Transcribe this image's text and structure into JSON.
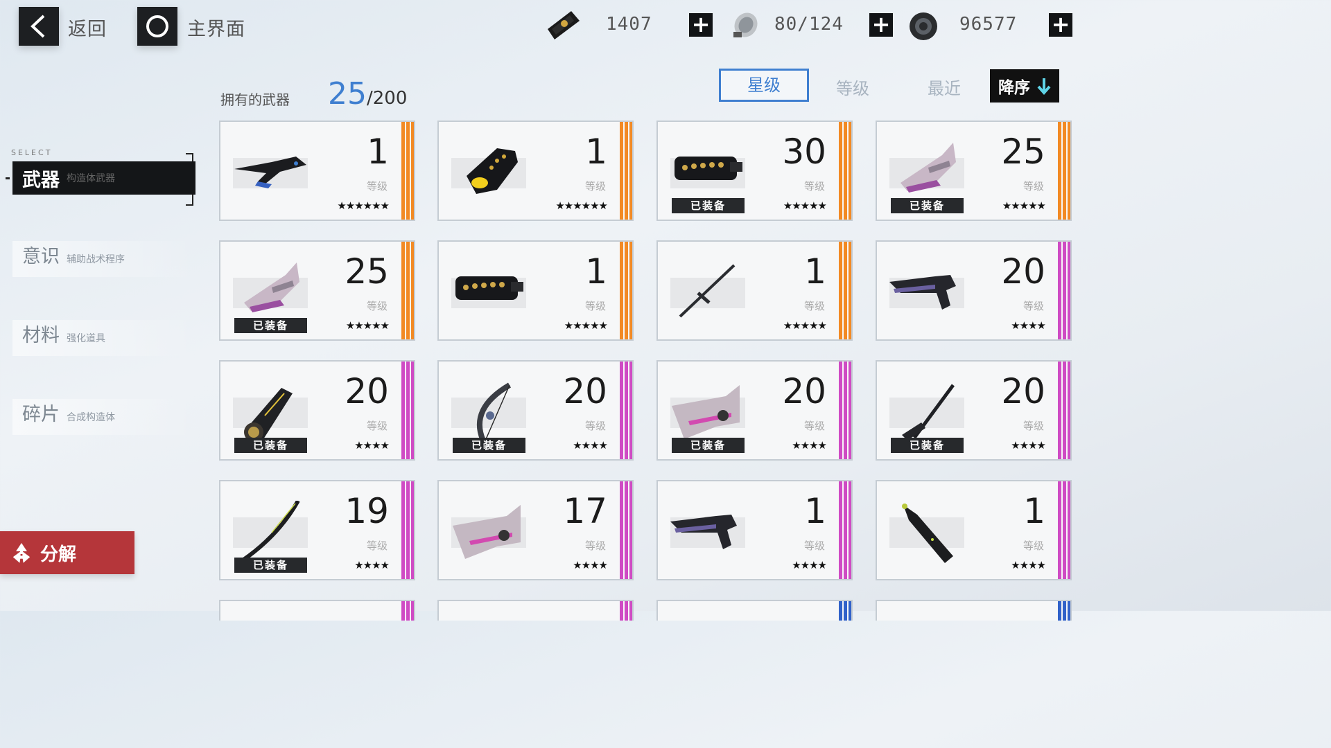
{
  "topbar": {
    "back_label": "返回",
    "home_label": "主界面",
    "resources": [
      {
        "name": "card-currency",
        "value": "1407"
      },
      {
        "name": "stamina",
        "value": "80/124"
      },
      {
        "name": "coins",
        "value": "96577"
      }
    ]
  },
  "header": {
    "owned_label": "拥有的武器",
    "owned_count": "25",
    "owned_max": "/200"
  },
  "sort": {
    "star": "星级",
    "level": "等级",
    "recent": "最近",
    "order": "降序"
  },
  "menu": {
    "select_label": "SELECT",
    "items": [
      {
        "title": "武器",
        "sub": "构造体武器"
      },
      {
        "title": "意识",
        "sub": "辅助战术程序"
      },
      {
        "title": "材料",
        "sub": "强化道具"
      },
      {
        "title": "碎片",
        "sub": "合成构造体"
      }
    ]
  },
  "card_labels": {
    "level": "等级",
    "equipped": "已装备"
  },
  "weapons": [
    {
      "level": "1",
      "stars": "★★★★★★",
      "equipped": false,
      "rarity": "orange",
      "icon": "blade-gun-icon"
    },
    {
      "level": "1",
      "stars": "★★★★★★",
      "equipped": false,
      "rarity": "orange",
      "icon": "gauntlet-icon"
    },
    {
      "level": "30",
      "stars": "★★★★★",
      "equipped": true,
      "rarity": "orange",
      "icon": "gatling-icon"
    },
    {
      "level": "25",
      "stars": "★★★★★",
      "equipped": true,
      "rarity": "orange",
      "icon": "mecha-cannon-icon"
    },
    {
      "level": "25",
      "stars": "★★★★★",
      "equipped": true,
      "rarity": "orange",
      "icon": "mecha-cannon-icon"
    },
    {
      "level": "1",
      "stars": "★★★★★",
      "equipped": false,
      "rarity": "orange",
      "icon": "gatling-icon"
    },
    {
      "level": "1",
      "stars": "★★★★★",
      "equipped": false,
      "rarity": "orange",
      "icon": "sword-icon"
    },
    {
      "level": "20",
      "stars": "★★★★",
      "equipped": false,
      "rarity": "purple",
      "icon": "pistol-icon"
    },
    {
      "level": "20",
      "stars": "★★★★",
      "equipped": true,
      "rarity": "purple",
      "icon": "launcher-icon"
    },
    {
      "level": "20",
      "stars": "★★★★",
      "equipped": true,
      "rarity": "purple",
      "icon": "bow-icon"
    },
    {
      "level": "20",
      "stars": "★★★★",
      "equipped": true,
      "rarity": "purple",
      "icon": "heavy-cannon-icon"
    },
    {
      "level": "20",
      "stars": "★★★★",
      "equipped": true,
      "rarity": "purple",
      "icon": "rifle-icon"
    },
    {
      "level": "19",
      "stars": "★★★★",
      "equipped": true,
      "rarity": "purple",
      "icon": "katana-icon"
    },
    {
      "level": "17",
      "stars": "★★★★",
      "equipped": false,
      "rarity": "purple",
      "icon": "heavy-cannon-icon"
    },
    {
      "level": "1",
      "stars": "★★★★",
      "equipped": false,
      "rarity": "purple",
      "icon": "pistol-icon"
    },
    {
      "level": "1",
      "stars": "★★★★",
      "equipped": false,
      "rarity": "purple",
      "icon": "greatsword-icon"
    }
  ],
  "partial_rarities": [
    "purple",
    "purple",
    "blue",
    "blue"
  ],
  "dismantle_label": "分解",
  "colors": {
    "orange": "#f28a24",
    "purple": "#cf4bc4",
    "blue": "#3162c9",
    "accent": "#3f7fd0",
    "dismantle": "#b5363a"
  }
}
